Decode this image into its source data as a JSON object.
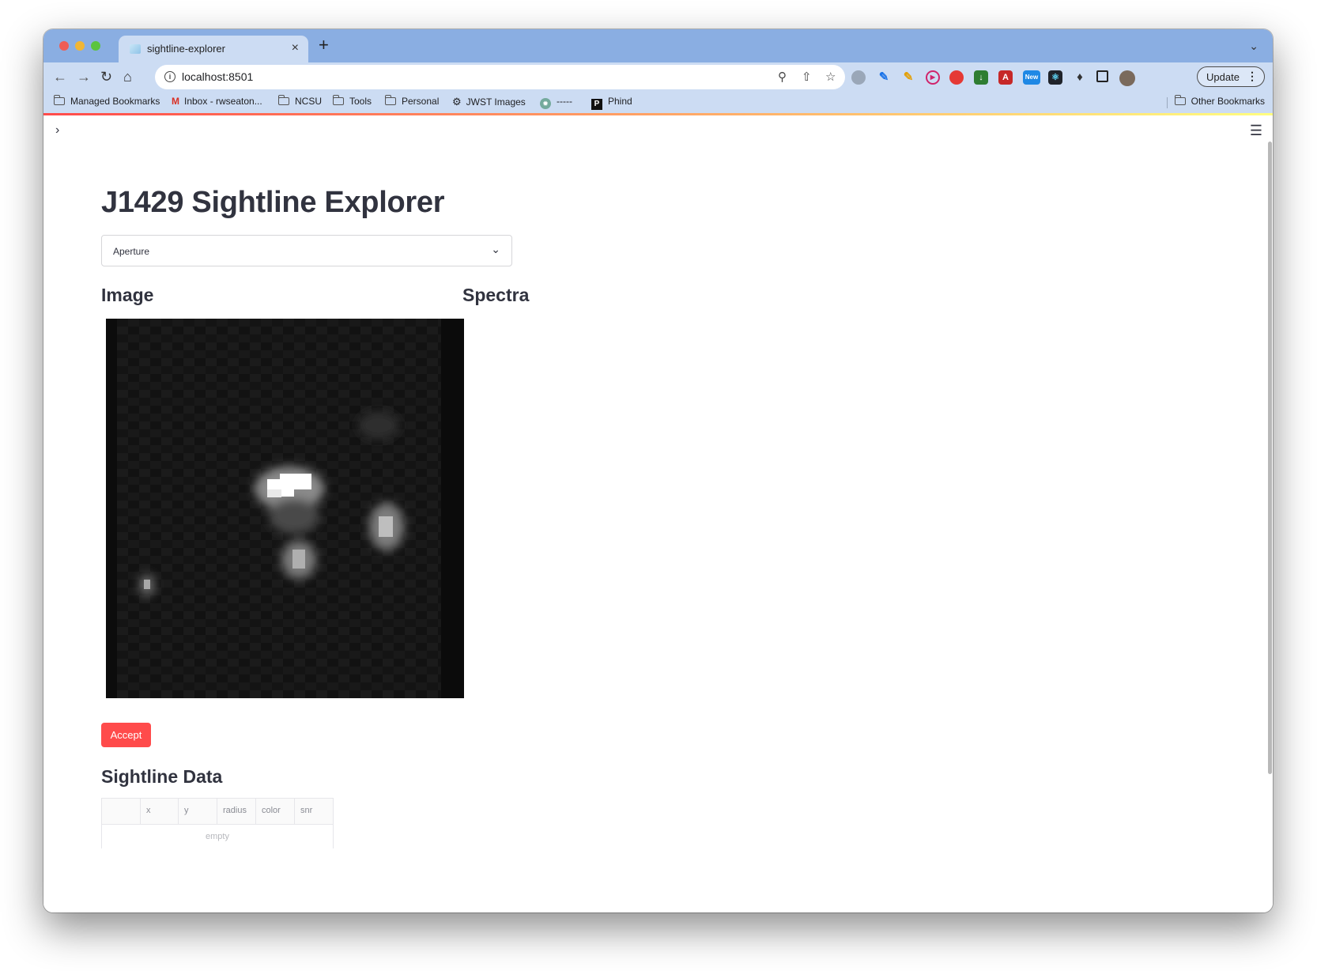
{
  "browser": {
    "tab_title": "sightline-explorer",
    "tab_close": "×",
    "new_tab": "+",
    "tabs_menu": "⌄",
    "url": "localhost:8501",
    "update_label": "Update",
    "bookmarks": [
      {
        "label": "Managed Bookmarks",
        "icon": "folder-icon"
      },
      {
        "label": "Inbox - rwseaton...",
        "icon": "gmail-icon"
      },
      {
        "label": "NCSU",
        "icon": "folder-icon"
      },
      {
        "label": "Tools",
        "icon": "folder-icon"
      },
      {
        "label": "Personal",
        "icon": "folder-icon"
      },
      {
        "label": "JWST Images",
        "icon": "gear-icon"
      },
      {
        "label": "-----",
        "icon": "chatgpt-icon"
      },
      {
        "label": "Phind",
        "icon": "phind-icon"
      }
    ],
    "other_bookmarks": "Other Bookmarks"
  },
  "app": {
    "title": "J1429 Sightline Explorer",
    "select": {
      "value": "Aperture",
      "options_visible": [
        "Aperture"
      ]
    },
    "image_heading": "Image",
    "spectra_heading": "Spectra",
    "accept_label": "Accept",
    "sightline_heading": "Sightline Data",
    "table": {
      "columns": [
        "",
        "x",
        "y",
        "radius",
        "color",
        "snr"
      ],
      "rows": [],
      "empty_text": "empty"
    }
  },
  "colors": {
    "accent": "#ff4b4b",
    "text": "#31333f",
    "browser_chrome": "#ccdcf3",
    "tabstrip": "#8aaee2"
  }
}
